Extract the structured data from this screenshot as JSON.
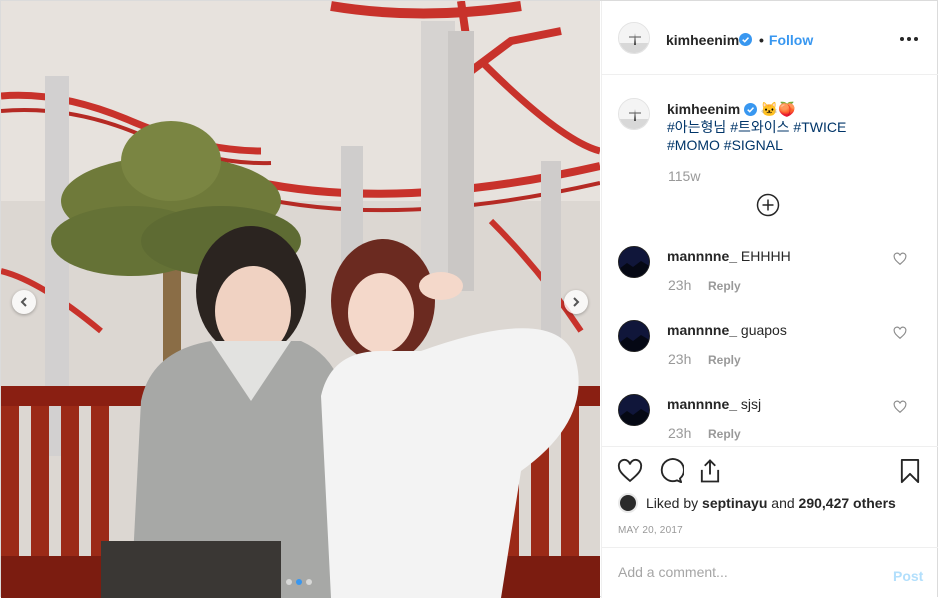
{
  "post": {
    "author": {
      "username": "kimheenim",
      "verified": true,
      "follow_separator": "•",
      "follow_label": "Follow"
    },
    "caption": {
      "username": "kimheenim",
      "emojis": "🐱🍑",
      "hashtags": [
        "#아는형님",
        "#트와이스",
        "#TWICE",
        "#MOMO",
        "#SIGNAL"
      ],
      "time": "115w"
    },
    "comments": [
      {
        "username": "mannnne_",
        "text": "EHHHH",
        "time": "23h",
        "reply_label": "Reply"
      },
      {
        "username": "mannnne_",
        "text": "guapos",
        "time": "23h",
        "reply_label": "Reply"
      },
      {
        "username": "mannnne_",
        "text": "sjsj",
        "time": "23h",
        "reply_label": "Reply"
      }
    ],
    "likes": {
      "prefix": "Liked by",
      "first_user": "septinayu",
      "conjunction": "and",
      "count_text": "290,427 others"
    },
    "date": "MAY 20, 2017",
    "comment_input": {
      "placeholder": "Add a comment..."
    },
    "post_button": "Post",
    "carousel": {
      "total": 3,
      "current": 2
    },
    "colors": {
      "accent": "#3897f0",
      "hashtag": "#003569",
      "muted": "#999999"
    }
  }
}
